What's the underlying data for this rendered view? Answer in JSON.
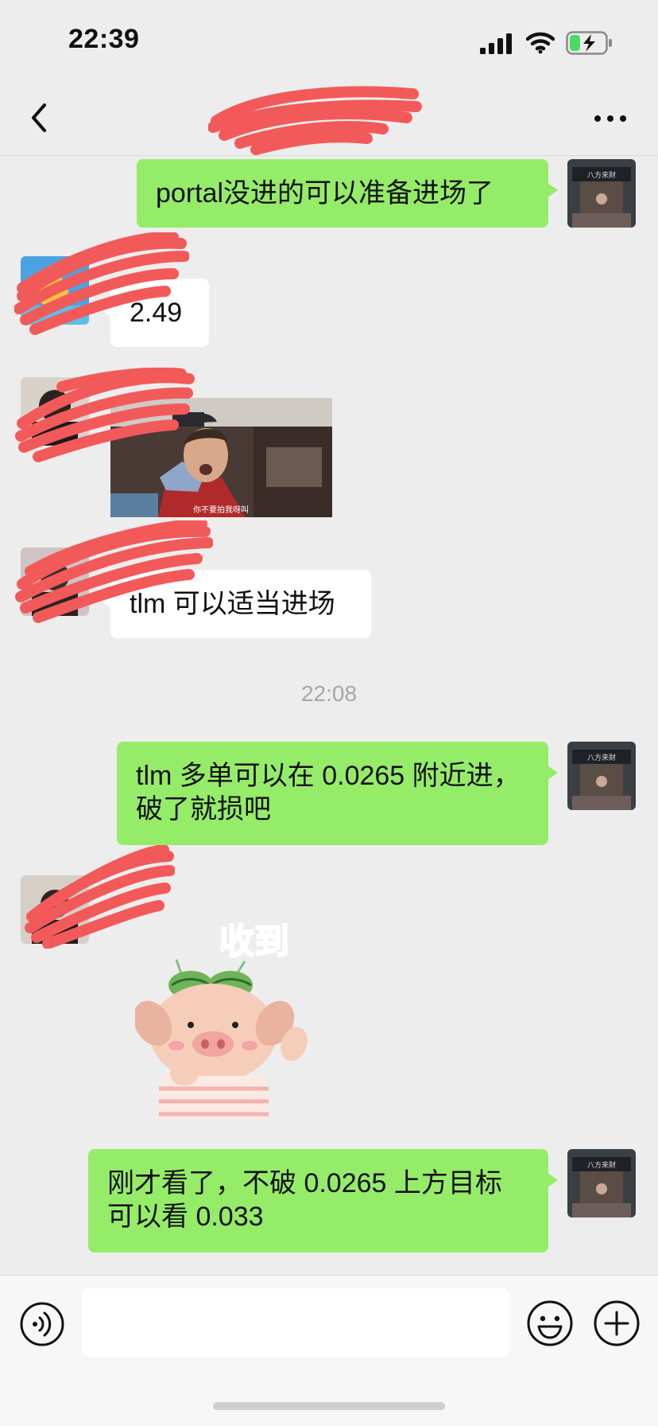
{
  "status_bar": {
    "time": "22:39"
  },
  "nav": {
    "title": ""
  },
  "messages": [
    {
      "side": "me",
      "text": "portal没进的可以准备进场了"
    },
    {
      "side": "other",
      "text": "2.49"
    },
    {
      "side": "other",
      "image": "video-frame-image",
      "caption": "你不要拍我呀叫"
    },
    {
      "side": "other",
      "text": "tlm 可以适当进场"
    },
    {
      "side": "me",
      "lines": [
        "tlm 多单可以在 0.0265 附近进，",
        "破了就损吧"
      ]
    },
    {
      "side": "other",
      "sticker": "pig-sticker",
      "sticker_text": "收到"
    },
    {
      "side": "me",
      "lines": [
        "刚才看了，不破 0.0265 上方目标",
        "可以看 0.033"
      ]
    }
  ],
  "timestamp": "22:08",
  "avatar_me_text": "八方来财",
  "input": {
    "placeholder": ""
  },
  "colors": {
    "bubble_me": "#95ec69",
    "bubble_other": "#ffffff",
    "background": "#ededed",
    "redaction": "#f25a5a"
  },
  "icons": [
    "signal-icon",
    "wifi-icon",
    "battery-charging-icon",
    "back-icon",
    "more-icon",
    "voice-icon",
    "emoji-icon",
    "plus-icon"
  ]
}
